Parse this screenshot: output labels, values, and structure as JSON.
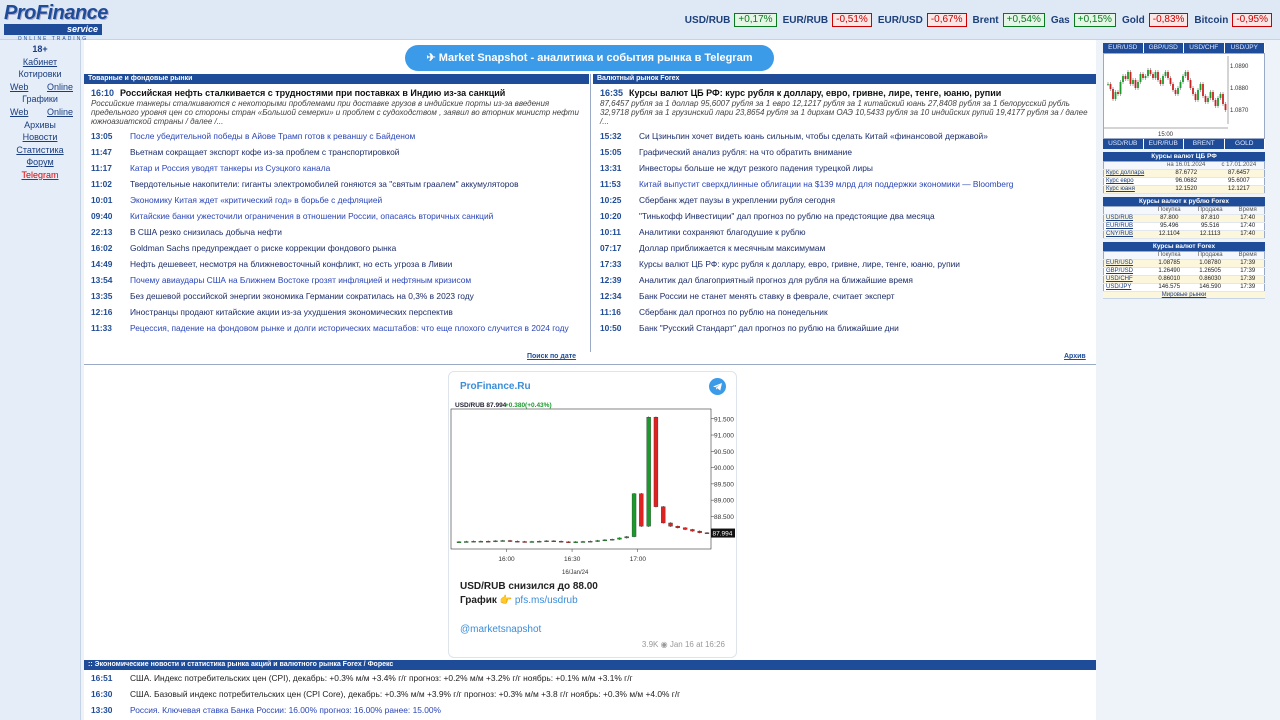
{
  "logo": {
    "line1": "ProFinance",
    "line2": "service",
    "line3": "ONLINE TRADING"
  },
  "tickers": [
    {
      "name": "USD/RUB",
      "chg": "+0,17%",
      "dir": "up"
    },
    {
      "name": "EUR/RUB",
      "chg": "-0,51%",
      "dir": "dn"
    },
    {
      "name": "EUR/USD",
      "chg": "-0,67%",
      "dir": "dn"
    },
    {
      "name": "Brent",
      "chg": "+0,54%",
      "dir": "up"
    },
    {
      "name": "Gas",
      "chg": "+0,15%",
      "dir": "up"
    },
    {
      "name": "Gold",
      "chg": "-0,83%",
      "dir": "dn"
    },
    {
      "name": "Bitcoin",
      "chg": "-0,95%",
      "dir": "dn"
    }
  ],
  "left_menu": {
    "age": "18+",
    "cabinet": "Кабинет",
    "quotes": "Котировки",
    "web": "Web",
    "online": "Online",
    "charts": "Графики",
    "archives": "Архивы",
    "news": "Новости",
    "stats": "Статистика",
    "forum": "Форум",
    "telegram": "Telegram"
  },
  "telegram_button": "Market Snapshot - аналитика и события рынка в Telegram",
  "commodity": {
    "header": "Товарные и фондовые рынки",
    "lead": {
      "time": "16:10",
      "title": "Российская нефть сталкивается с трудностями при поставках в Индию из-за санкций",
      "desc": "Российские танкеры сталкиваются с некоторыми проблемами при доставке грузов в индийские порты из-за введения предельного уровня цен со стороны стран «Большой семерки» и проблем с судоходством , заявил во вторник министр нефти южноазиатской страны / далее /..."
    },
    "items": [
      {
        "time": "13:05",
        "title": "После убедительной победы в Айове Трамп готов к реваншу с Байденом",
        "blue": true
      },
      {
        "time": "11:47",
        "title": "Вьетнам сокращает экспорт кофе из-за проблем с транспортировкой",
        "blue": false
      },
      {
        "time": "11:17",
        "title": "Катар и Россия уводят танкеры из Суэцкого канала",
        "blue": true
      },
      {
        "time": "11:02",
        "title": "Твердотельные накопители: гиганты электромобилей гоняются за \"святым граалем\" аккумуляторов",
        "blue": false
      },
      {
        "time": "10:01",
        "title": "Экономику Китая ждет «критический год» в борьбе с дефляцией",
        "blue": true
      },
      {
        "time": "09:40",
        "title": "Китайские банки ужесточили ограничения в отношении России, опасаясь вторичных санкций",
        "blue": true
      },
      {
        "time": "22:13",
        "title": "В США резко снизилась добыча нефти",
        "blue": false
      },
      {
        "time": "16:02",
        "title": "Goldman Sachs предупреждает о риске коррекции фондового рынка",
        "blue": false
      },
      {
        "time": "14:49",
        "title": "Нефть дешевеет, несмотря на ближневосточный конфликт, но есть угроза в Ливии",
        "blue": false
      },
      {
        "time": "13:54",
        "title": "Почему авиаудары США на Ближнем Востоке грозят инфляцией и нефтяным кризисом",
        "blue": true
      },
      {
        "time": "13:35",
        "title": "Без дешевой российской энергии экономика Германии сократилась на 0,3% в 2023 году",
        "blue": false
      },
      {
        "time": "12:16",
        "title": "Иностранцы продают китайские акции из-за ухудшения экономических перспектив",
        "blue": false
      },
      {
        "time": "11:33",
        "title": "Рецессия, падение на фондовом рынке и долги исторических масштабов: что еще плохого случится в 2024 году",
        "blue": true
      }
    ],
    "more": "Поиск по дате"
  },
  "forex": {
    "header": "Валютный рынок Forex",
    "lead": {
      "time": "16:35",
      "title": "Курсы валют ЦБ РФ: курс рубля к доллару, евро, гривне, лире, тенге, юаню, рупии",
      "desc": "87,6457 рубля за 1 доллар 95,6007 рубля за 1 евро 12,1217 рубля за 1 китайский юань 27,8408 рубля за 1 белорусский рубль 32,9718 рубля за 1 грузинский лари 23,8654 рубля за 1 дирхам ОАЭ 10,5433 рубля за 10 индийских рупий 19,4177 рубля за / далее /..."
    },
    "items": [
      {
        "time": "15:32",
        "title": "Си Цзиньпин хочет видеть юань сильным, чтобы сделать Китай «финансовой державой»",
        "blue": false
      },
      {
        "time": "15:05",
        "title": "Графический анализ рубля: на что обратить внимание",
        "blue": false
      },
      {
        "time": "13:31",
        "title": "Инвесторы больше не ждут резкого падения турецкой лиры",
        "blue": false
      },
      {
        "time": "11:53",
        "title": "Китай выпустит сверхдлинные облигации на $139 млрд для поддержки экономики — Bloomberg",
        "blue": true
      },
      {
        "time": "10:25",
        "title": "Сбербанк ждет паузы в укреплении рубля сегодня",
        "blue": false
      },
      {
        "time": "10:20",
        "title": "\"Тинькофф Инвестиции\" дал прогноз по рублю на предстоящие два месяца",
        "blue": false
      },
      {
        "time": "10:11",
        "title": "Аналитики сохраняют благодушие к рублю",
        "blue": false
      },
      {
        "time": "07:17",
        "title": "Доллар приближается к месячным максимумам",
        "blue": false
      },
      {
        "time": "17:33",
        "title": "Курсы валют ЦБ РФ: курс рубля к доллару, евро, гривне, лире, тенге, юаню, рупии",
        "blue": false
      },
      {
        "time": "12:39",
        "title": "Аналитик дал благоприятный прогноз для рубля на ближайшие время",
        "blue": false
      },
      {
        "time": "12:34",
        "title": "Банк России не станет менять ставку в феврале, считает эксперт",
        "blue": false
      },
      {
        "time": "11:16",
        "title": "Сбербанк дал прогноз по рублю на понедельник",
        "blue": false
      },
      {
        "time": "10:50",
        "title": "Банк \"Русский Стандарт\" дал прогноз по рублю на ближайшие дни",
        "blue": false
      }
    ],
    "more": "Архив"
  },
  "telegram_card": {
    "source": "ProFinance.Ru",
    "chart_title": "USD/RUB",
    "chart_last": "87.994",
    "chart_change": "+0.380(+0.43%)",
    "caption1": "USD/RUB снизился до",
    "caption1_value": "88.00",
    "caption2": "График 👉",
    "caption2_link": "pfs.ms/usdrub",
    "account": "@marketsnapshot",
    "views": "3.9K",
    "date": "Jan 16 at 16:26"
  },
  "chart_data": {
    "type": "line",
    "title": "USD/RUB",
    "x_ticks": [
      "16:00",
      "16:30",
      "17:00"
    ],
    "x_label": "16/Jan/24",
    "y_ticks": [
      "91.500",
      "91.000",
      "90.500",
      "90.000",
      "89.500",
      "89.000",
      "88.500",
      "88.000"
    ],
    "ylim": [
      87.5,
      91.8
    ],
    "last_value_label": "87.994",
    "series": [
      {
        "values": [
          87.72,
          87.73,
          87.74,
          87.74,
          87.73,
          87.75,
          87.76,
          87.74,
          87.73,
          87.72,
          87.73,
          87.74,
          87.75,
          87.74,
          87.72,
          87.71,
          87.72,
          87.73,
          87.74,
          87.76,
          87.78,
          87.8,
          87.84,
          87.88,
          89.2,
          88.2,
          91.55,
          88.8,
          88.3,
          88.2,
          88.15,
          88.1,
          88.05,
          88.0,
          87.99
        ]
      }
    ]
  },
  "econ": {
    "header": ":: Экономические новости и статистика рынка акций и валютного рынка Forex / Форекс",
    "rows": [
      {
        "time": "16:51",
        "text": "США. Индекс потребительских цен (CPI), декабрь: +0.3% м/м +3.4% г/г прогноз: +0.2% м/м +3.2% г/г ноябрь: +0.1% м/м +3.1% г/г"
      },
      {
        "time": "16:30",
        "text": "США. Базовый индекс потребительских цен (CPI Core), декабрь: +0.3% м/м +3.9% г/г прогноз: +0.3% м/м +3.8 г/г ноябрь: +0.3% м/м +4.0% г/г"
      },
      {
        "time": "13:30",
        "text": "Россия. Ключевая ставка Банка России: 16.00% прогноз: 16.00% ранее: 15.00%"
      }
    ]
  },
  "right": {
    "tabs_top": [
      "EUR/USD",
      "GBP/USD",
      "USD/CHF",
      "USD/JPY"
    ],
    "tabs_bottom": [
      "USD/RUB",
      "EUR/RUB",
      "BRENT",
      "GOLD"
    ],
    "mini_prices": [
      "1.0890",
      "1.0880",
      "1.0870"
    ],
    "mini_time": "15:00",
    "cb": {
      "header": "Курсы валют ЦБ РФ",
      "col1": "на 16.01.2024",
      "col2": "с 17.01.2024",
      "rows": [
        [
          "Курс доллара",
          "87.6772",
          "87.6457"
        ],
        [
          "Курс евро",
          "96.0682",
          "95.6007"
        ],
        [
          "Курс юаня",
          "12.1520",
          "12.1217"
        ]
      ]
    },
    "forex_rub": {
      "header": "Курсы валют к рублю Forex",
      "cols": [
        "Покупка",
        "Продажа",
        "Время"
      ],
      "rows": [
        [
          "USD/RUB",
          "87.800",
          "87.810",
          "17:40"
        ],
        [
          "EUR/RUB",
          "95.496",
          "95.516",
          "17:40"
        ],
        [
          "CNY/RUB",
          "12.1104",
          "12.1113",
          "17:40"
        ]
      ]
    },
    "forex": {
      "header": "Курсы валют Forex",
      "cols": [
        "Покупка",
        "Продажа",
        "Время"
      ],
      "rows": [
        [
          "EUR/USD",
          "1.08785",
          "1.08780",
          "17:39"
        ],
        [
          "GBP/USD",
          "1.26490",
          "1.26505",
          "17:39"
        ],
        [
          "USD/CHF",
          "0.86010",
          "0.86030",
          "17:39"
        ],
        [
          "USD/JPY",
          "146.575",
          "146.590",
          "17:39"
        ]
      ],
      "footer": "Мировые рынки"
    }
  }
}
